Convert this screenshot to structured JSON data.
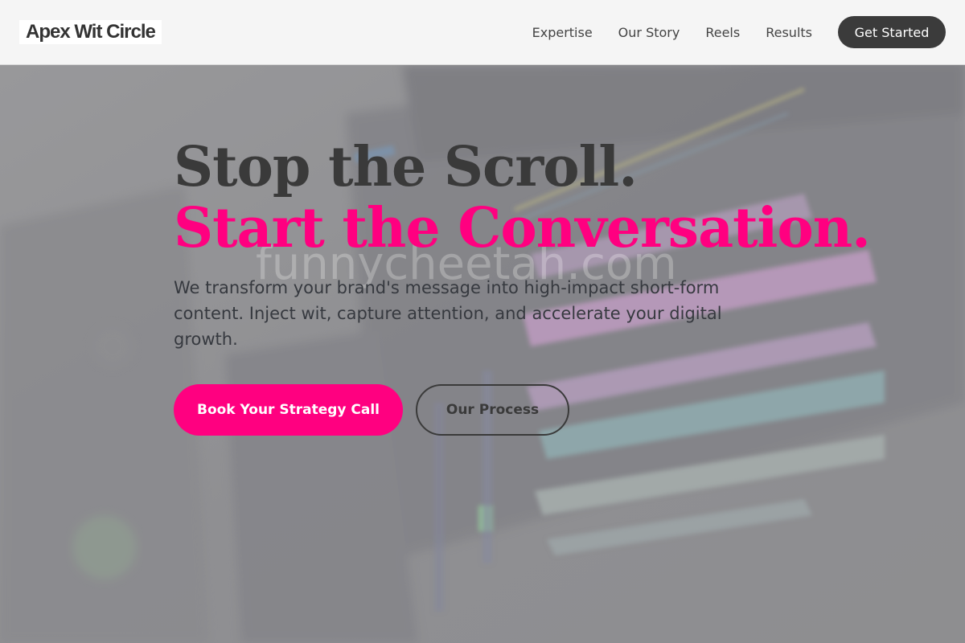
{
  "header": {
    "logo": "Apex Wit Circle",
    "nav": [
      "Expertise",
      "Our Story",
      "Reels",
      "Results"
    ],
    "cta": "Get Started"
  },
  "hero": {
    "title_line1": "Stop the Scroll.",
    "title_line2": "Start the Conversation.",
    "lead": "We transform your brand's message into high-impact short-form content. Inject wit, capture attention, and accelerate your digital growth.",
    "primary_button": "Book Your Strategy Call",
    "secondary_button": "Our Process",
    "watermark": "funnycheetah.com"
  },
  "colors": {
    "accent": "#ff0080",
    "dark": "#3a3a3a",
    "header_bg": "#f5f5f5"
  }
}
